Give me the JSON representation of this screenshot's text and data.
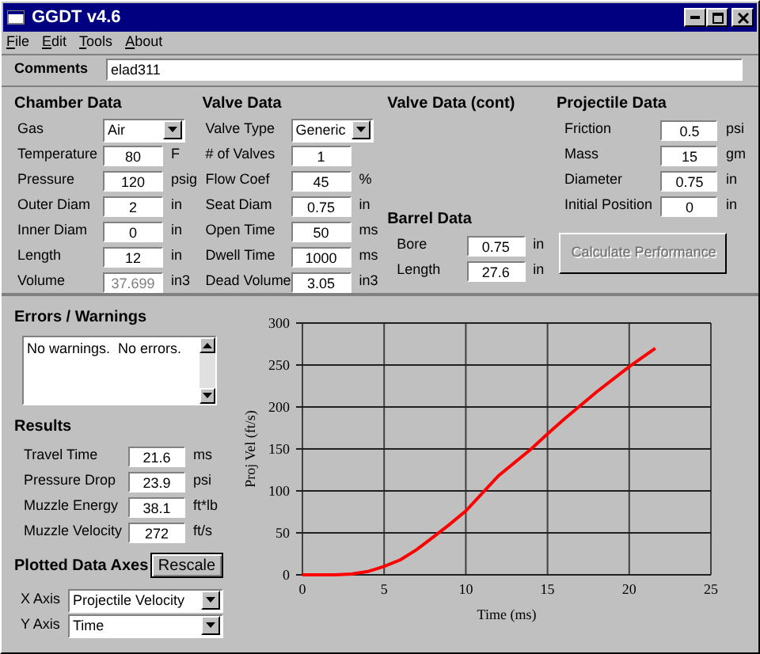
{
  "window": {
    "title": "GGDT v4.6"
  },
  "menu": [
    "File",
    "Edit",
    "Tools",
    "About"
  ],
  "comments": {
    "label": "Comments",
    "value": "elad311"
  },
  "chamber": {
    "title": "Chamber Data",
    "fields": [
      {
        "kind": "select",
        "label": "Gas",
        "value": "Air",
        "disabled": false
      },
      {
        "kind": "input",
        "label": "Temperature",
        "value": "80",
        "unit": "F",
        "disabled": false
      },
      {
        "kind": "input",
        "label": "Pressure",
        "value": "120",
        "unit": "psig",
        "disabled": false
      },
      {
        "kind": "input",
        "label": "Outer Diam",
        "value": "2",
        "unit": "in",
        "disabled": false
      },
      {
        "kind": "input",
        "label": "Inner Diam",
        "value": "0",
        "unit": "in",
        "disabled": false
      },
      {
        "kind": "input",
        "label": "Length",
        "value": "12",
        "unit": "in",
        "disabled": false
      },
      {
        "kind": "input",
        "label": "Volume",
        "value": "37.699",
        "unit": "in3",
        "disabled": true
      }
    ]
  },
  "valve": {
    "title": "Valve Data",
    "fields": [
      {
        "kind": "select",
        "label": "Valve Type",
        "value": "Generic",
        "disabled": false
      },
      {
        "kind": "input",
        "label": "# of Valves",
        "value": "1",
        "disabled": false
      },
      {
        "kind": "input",
        "label": "Flow Coef",
        "value": "45",
        "unit": "%",
        "disabled": false
      },
      {
        "kind": "input",
        "label": "Seat Diam",
        "value": "0.75",
        "unit": "in",
        "disabled": false
      },
      {
        "kind": "input",
        "label": "Open Time",
        "value": "50",
        "unit": "ms",
        "disabled": false
      },
      {
        "kind": "input",
        "label": "Dwell Time",
        "value": "1000",
        "unit": "ms",
        "disabled": false
      },
      {
        "kind": "input",
        "label": "Dead Volume",
        "value": "3.05",
        "unit": "in3",
        "disabled": false
      }
    ]
  },
  "valve_cont": {
    "title": "Valve Data (cont)"
  },
  "barrel": {
    "title": "Barrel Data",
    "fields": [
      {
        "kind": "input",
        "label": "Bore",
        "value": "0.75",
        "unit": "in",
        "disabled": false
      },
      {
        "kind": "input",
        "label": "Length",
        "value": "27.6",
        "unit": "in",
        "disabled": false
      }
    ]
  },
  "projectile": {
    "title": "Projectile Data",
    "fields": [
      {
        "kind": "input",
        "label": "Friction",
        "value": "0.5",
        "unit": "psi",
        "disabled": false
      },
      {
        "kind": "input",
        "label": "Mass",
        "value": "15",
        "unit": "gm",
        "disabled": false
      },
      {
        "kind": "input",
        "label": "Diameter",
        "value": "0.75",
        "unit": "in",
        "disabled": false
      },
      {
        "kind": "input",
        "label": "Initial Position",
        "value": "0",
        "unit": "in",
        "disabled": false
      }
    ]
  },
  "calculate_button": {
    "label": "Calculate Performance",
    "disabled": true
  },
  "errors": {
    "title": "Errors / Warnings",
    "text": "No warnings.  No errors."
  },
  "results": {
    "title": "Results",
    "fields": [
      {
        "kind": "input",
        "label": "Travel Time",
        "value": "21.6",
        "unit": "ms",
        "disabled": false
      },
      {
        "kind": "input",
        "label": "Pressure Drop",
        "value": "23.9",
        "unit": "psi",
        "disabled": false
      },
      {
        "kind": "input",
        "label": "Muzzle Energy",
        "value": "38.1",
        "unit": "ft*lb",
        "disabled": false
      },
      {
        "kind": "input",
        "label": "Muzzle Velocity",
        "value": "272",
        "unit": "ft/s",
        "disabled": false
      }
    ]
  },
  "plot_axes": {
    "title": "Plotted Data Axes",
    "rescale_button": "Rescale",
    "fields": [
      {
        "kind": "select",
        "label": "X Axis",
        "value": "Projectile Velocity",
        "disabled": false
      },
      {
        "kind": "select",
        "label": "Y Axis",
        "value": "Time",
        "disabled": false
      }
    ]
  },
  "chart": {
    "chart_data": {
      "type": "line",
      "grid": true,
      "xlabel": "Time (ms)",
      "ylabel": "Proj Vel (ft/s)",
      "xlim": [
        0,
        25
      ],
      "ylim": [
        0,
        300
      ],
      "xticks": [
        0,
        5,
        10,
        15,
        20,
        25
      ],
      "yticks": [
        0,
        50,
        100,
        150,
        200,
        250,
        300
      ],
      "x": [
        0,
        2,
        3,
        4,
        5,
        6,
        7,
        8,
        9,
        10,
        12,
        14,
        15,
        16,
        18,
        20,
        21.6
      ],
      "series": [
        {
          "color": "#ff0000",
          "values": [
            0,
            0,
            1,
            4,
            10,
            18,
            30,
            45,
            60,
            76,
            118,
            150,
            168,
            185,
            218,
            248,
            270
          ]
        }
      ]
    }
  }
}
